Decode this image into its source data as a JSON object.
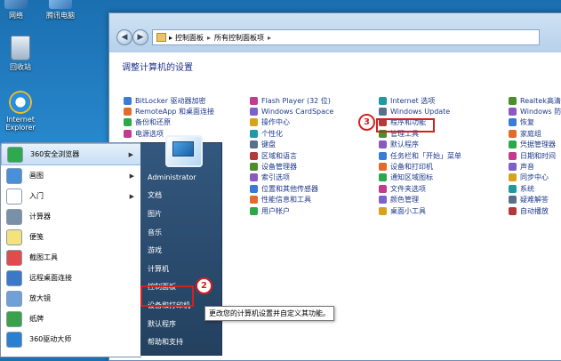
{
  "desktop": {
    "icons": [
      {
        "label": "网络"
      },
      {
        "label": "腾讯电脑"
      },
      {
        "label": "回收站"
      },
      {
        "label": "Internet Explorer"
      }
    ]
  },
  "control_panel": {
    "address": {
      "crumb1": "控制面板",
      "crumb2": "所有控制面板项"
    },
    "heading": "调整计算机的设置",
    "columns": [
      {
        "items": [
          "BitLocker 驱动器加密",
          "RemoteApp 和桌面连接",
          "备份和还原",
          "电源选项"
        ]
      },
      {
        "items": [
          "Flash Player (32 位)",
          "Windows CardSpace",
          "操作中心",
          "个性化",
          "键盘",
          "区域和语言",
          "设备管理器",
          "索引选项",
          "位置和其他传感器",
          "性能信息和工具",
          "用户帐户"
        ]
      },
      {
        "items": [
          "Internet 选项",
          "Windows Update",
          "程序和功能",
          "管理工具",
          "默认程序",
          "任务栏和「开始」菜单",
          "设备和打印机",
          "通知区域图标",
          "文件夹选项",
          "颜色管理",
          "桌面小工具"
        ]
      },
      {
        "items": [
          "Realtek高清晰",
          "Windows 防火",
          "恢复",
          "家庭组",
          "凭据管理器",
          "日期和时间",
          "声音",
          "同步中心",
          "系统",
          "疑难解答",
          "自动播放"
        ]
      }
    ],
    "badge_3": "3",
    "colors": {
      "link": "#1e3a8a",
      "highlight": "#d42020"
    }
  },
  "start_menu": {
    "left_items": [
      {
        "label": "360安全浏览器",
        "has_arrow": true
      },
      {
        "label": "画图",
        "has_arrow": true
      },
      {
        "label": "入门",
        "has_arrow": true
      },
      {
        "label": "计算器",
        "has_arrow": false
      },
      {
        "label": "便笺",
        "has_arrow": false
      },
      {
        "label": "截图工具",
        "has_arrow": false
      },
      {
        "label": "远程桌面连接",
        "has_arrow": false
      },
      {
        "label": "放大镜",
        "has_arrow": false
      },
      {
        "label": "纸牌",
        "has_arrow": false
      },
      {
        "label": "360驱动大师",
        "has_arrow": false
      }
    ],
    "right_items": [
      "Administrator",
      "文档",
      "图片",
      "音乐",
      "游戏",
      "计算机",
      "控制面板",
      "设备和打印机",
      "默认程序",
      "帮助和支持"
    ],
    "badge_2": "2",
    "tooltip": "更改您的计算机设置并自定义其功能。"
  }
}
